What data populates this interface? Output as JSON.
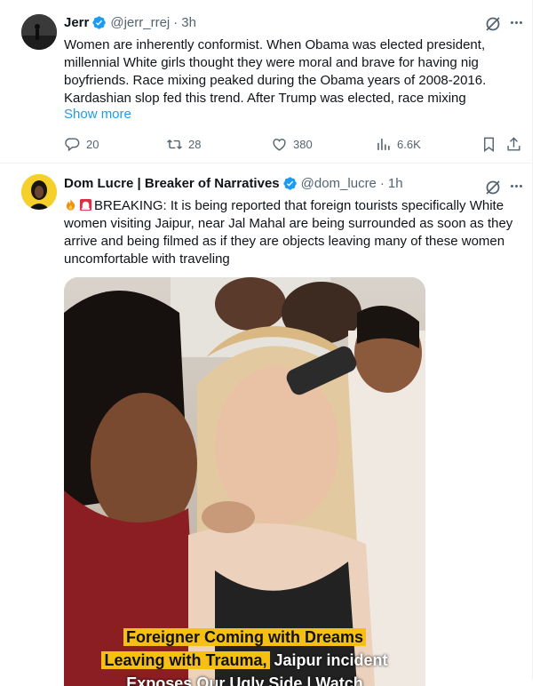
{
  "tweets": [
    {
      "name": "Jerr",
      "handle": "@jerr_rrej",
      "separator": "·",
      "time": "3h",
      "text": "Women are inherently conformist. When Obama was elected president, millennial White girls thought they were moral and brave for having nig boyfriends. Race mixing peaked during the Obama years of 2008-2016. Kardashian slop fed this trend. After Trump was elected, race mixing",
      "show_more": "Show more",
      "replies": "20",
      "reposts": "28",
      "likes": "380",
      "views": "6.6K"
    },
    {
      "name": "Dom Lucre | Breaker of Narratives",
      "handle": "@dom_lucre",
      "separator": "·",
      "time": "1h",
      "text": "BREAKING: It is being reported that foreign tourists specifically White women visiting Jaipur, near Jal Mahal are being surrounded as soon as they arrive and being filmed as if they are objects leaving many of these women uncomfortable with traveling",
      "media": {
        "caption_line1": "Foreigner Coming with Dreams",
        "caption_line2_highlight": "Leaving with Trauma,",
        "caption_line2_rest": " Jaipur incident",
        "caption_line3": "Exposes Our Ugly Side | Watch"
      }
    }
  ],
  "colors": {
    "accent": "#1d9bf0",
    "muted": "#536471",
    "text": "#0f1419",
    "highlight": "#f6c012"
  },
  "icons": [
    "verified-badge-icon",
    "grok-icon",
    "more-icon",
    "reply-icon",
    "repost-icon",
    "like-icon",
    "views-icon",
    "bookmark-icon",
    "share-icon",
    "fire-emoji",
    "siren-emoji"
  ]
}
